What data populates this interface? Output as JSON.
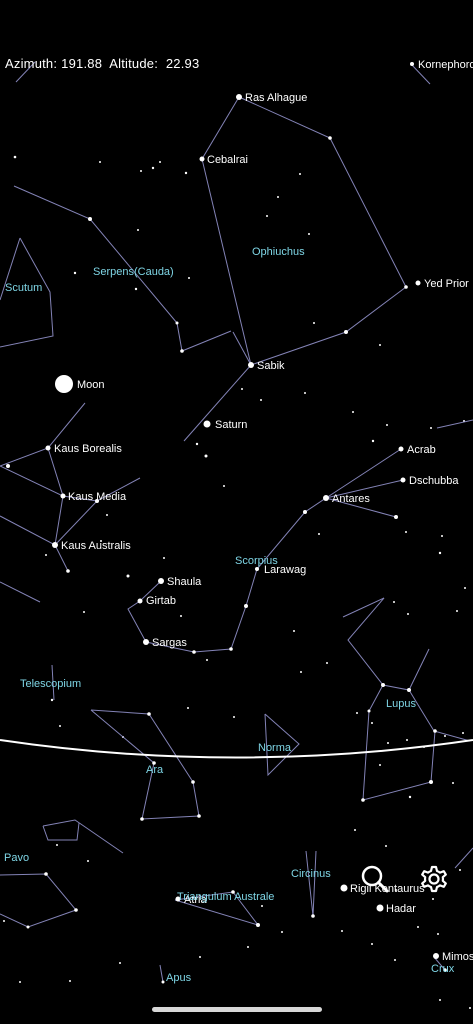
{
  "readout": {
    "azimuth_label": "Azimuth:",
    "azimuth_value": "191.88",
    "altitude_label": "Altitude:",
    "altitude_value": "22.93"
  },
  "stars": [
    {
      "name": "Ras Alhague"
    },
    {
      "name": "Cebalrai"
    },
    {
      "name": "Yed Prior"
    },
    {
      "name": "Sabik"
    },
    {
      "name": "Saturn"
    },
    {
      "name": "Moon"
    },
    {
      "name": "Kaus Borealis"
    },
    {
      "name": "Kaus Media"
    },
    {
      "name": "Kaus Australis"
    },
    {
      "name": "Acrab"
    },
    {
      "name": "Dschubba"
    },
    {
      "name": "Antares"
    },
    {
      "name": "Larawag"
    },
    {
      "name": "Shaula"
    },
    {
      "name": "Girtab"
    },
    {
      "name": "Sargas"
    },
    {
      "name": "Rigil Kentaurus"
    },
    {
      "name": "Hadar"
    },
    {
      "name": "Atria"
    },
    {
      "name": "Mimosa"
    },
    {
      "name": "Kornephoros"
    }
  ],
  "constellations": [
    {
      "name": "Ophiuchus"
    },
    {
      "name": "Serpens(Cauda)"
    },
    {
      "name": "Scutum"
    },
    {
      "name": "Scorpius"
    },
    {
      "name": "Telescopium"
    },
    {
      "name": "Lupus"
    },
    {
      "name": "Norma"
    },
    {
      "name": "Ara"
    },
    {
      "name": "Pavo"
    },
    {
      "name": "Circinus"
    },
    {
      "name": "Triangulum Australe"
    },
    {
      "name": "Crux"
    },
    {
      "name": "Apus"
    }
  ],
  "controls": {
    "search_icon": "search-icon",
    "settings_icon": "gear-icon"
  },
  "colors": {
    "background": "#000000",
    "constellation_lines": "#9a9ad6",
    "constellation_labels": "#7fd6e6",
    "star_labels": "#ffffff",
    "horizon": "#ffffff"
  }
}
